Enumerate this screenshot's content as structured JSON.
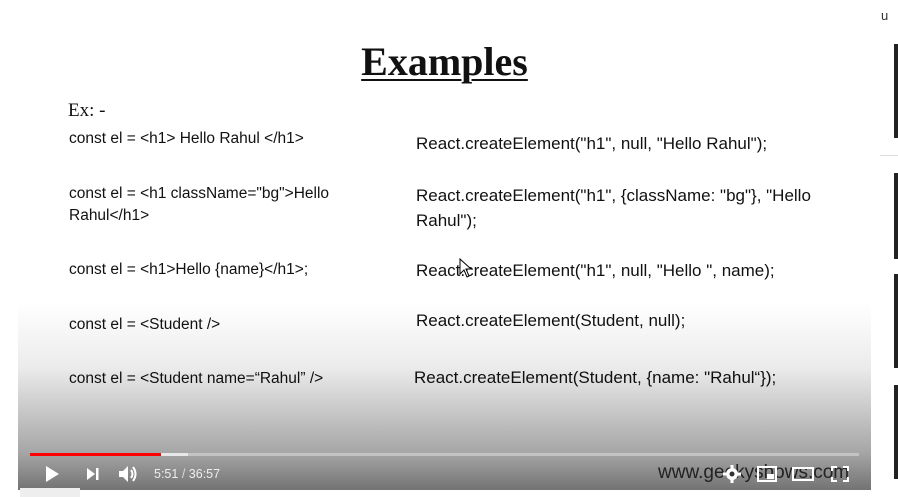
{
  "slide": {
    "title": "Examples",
    "ex_label": "Ex: -",
    "rows": [
      {
        "jsx": "const el = <h1> Hello Rahul </h1>",
        "code": "React.createElement(\"h1\", null, \"Hello Rahul\");"
      },
      {
        "jsx": "const el =  <h1 className=\"bg\">Hello Rahul</h1>",
        "code": "React.createElement(\"h1\", {className: \"bg\"}, \"Hello Rahul\");"
      },
      {
        "jsx": "const el = <h1>Hello {name}</h1>;",
        "code": "React.createElement(\"h1\", null, \"Hello \", name);"
      },
      {
        "jsx": "const el =  <Student />",
        "code": "React.createElement(Student, null);"
      },
      {
        "jsx": "const el =  <Student name=“Rahul” />",
        "code": "React.createElement(Student, {name: \"Rahul“});"
      }
    ]
  },
  "player": {
    "current_time": "5:51",
    "time_separator": "/",
    "duration": "36:57",
    "played_fraction": 0.158,
    "buffered_fraction": 0.19,
    "watermark": "www.geekyshows.com",
    "progress_color": "#ff0000",
    "icons": {
      "play": "play-icon",
      "next": "next-icon",
      "volume": "volume-icon",
      "settings": "gear-icon",
      "miniplayer": "miniplayer-icon",
      "theater": "theater-icon",
      "fullscreen": "fullscreen-icon"
    }
  },
  "sidebar": {
    "partial_text": "u"
  }
}
